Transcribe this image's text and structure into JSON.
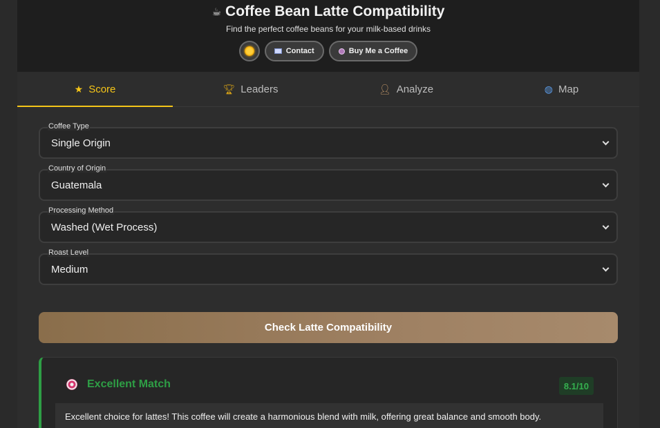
{
  "header": {
    "title": "Coffee Bean Latte Compatibility",
    "subtitle": "Find the perfect coffee beans for your milk-based drinks",
    "theme_toggle_icon": "sun-icon",
    "contact_label": "Contact",
    "buy_coffee_label": "Buy Me a Coffee"
  },
  "tabs": [
    {
      "label": "Score",
      "icon": "star-icon",
      "active": true
    },
    {
      "label": "Leaders",
      "icon": "trophy-icon",
      "active": false
    },
    {
      "label": "Analyze",
      "icon": "person-laptop-icon",
      "active": false
    },
    {
      "label": "Map",
      "icon": "globe-icon",
      "active": false
    }
  ],
  "form": {
    "coffee_type": {
      "label": "Coffee Type",
      "value": "Single Origin"
    },
    "country": {
      "label": "Country of Origin",
      "value": "Guatemala"
    },
    "processing": {
      "label": "Processing Method",
      "value": "Washed (Wet Process)"
    },
    "roast": {
      "label": "Roast Level",
      "value": "Medium"
    }
  },
  "check_button_label": "Check Latte Compatibility",
  "result": {
    "title": "Excellent Match",
    "score": "8.1/10",
    "description": "Excellent choice for lattes! This coffee will create a harmonious blend with milk, offering great balance and smooth body.",
    "accent_color": "#2e9e45"
  },
  "colors": {
    "accent": "#f5c518",
    "button": "#9e8062",
    "success": "#2e9e45"
  }
}
